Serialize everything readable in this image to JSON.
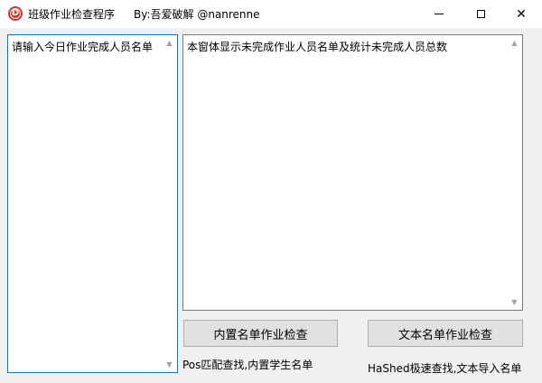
{
  "window": {
    "title": "班级作业检查程序",
    "author": "By:吾爱破解 @nanrenne",
    "icon_glyph": "D",
    "accent_color": "#d9312b"
  },
  "left_textbox": {
    "value": "请输入今日作业完成人员名单"
  },
  "right_textbox": {
    "value": "本窗体显示未完成作业人员名单及统计未完成人员总数"
  },
  "buttons": {
    "builtin_check": "内置名单作业检查",
    "text_check": "文本名单作业检查"
  },
  "notes": {
    "pos": "Pos匹配查找,内置学生名单",
    "hash": "HaShed极速查找,文本导入名单"
  },
  "icons": {
    "scroll_up": "▲",
    "scroll_down": "▼",
    "close": "✕"
  }
}
